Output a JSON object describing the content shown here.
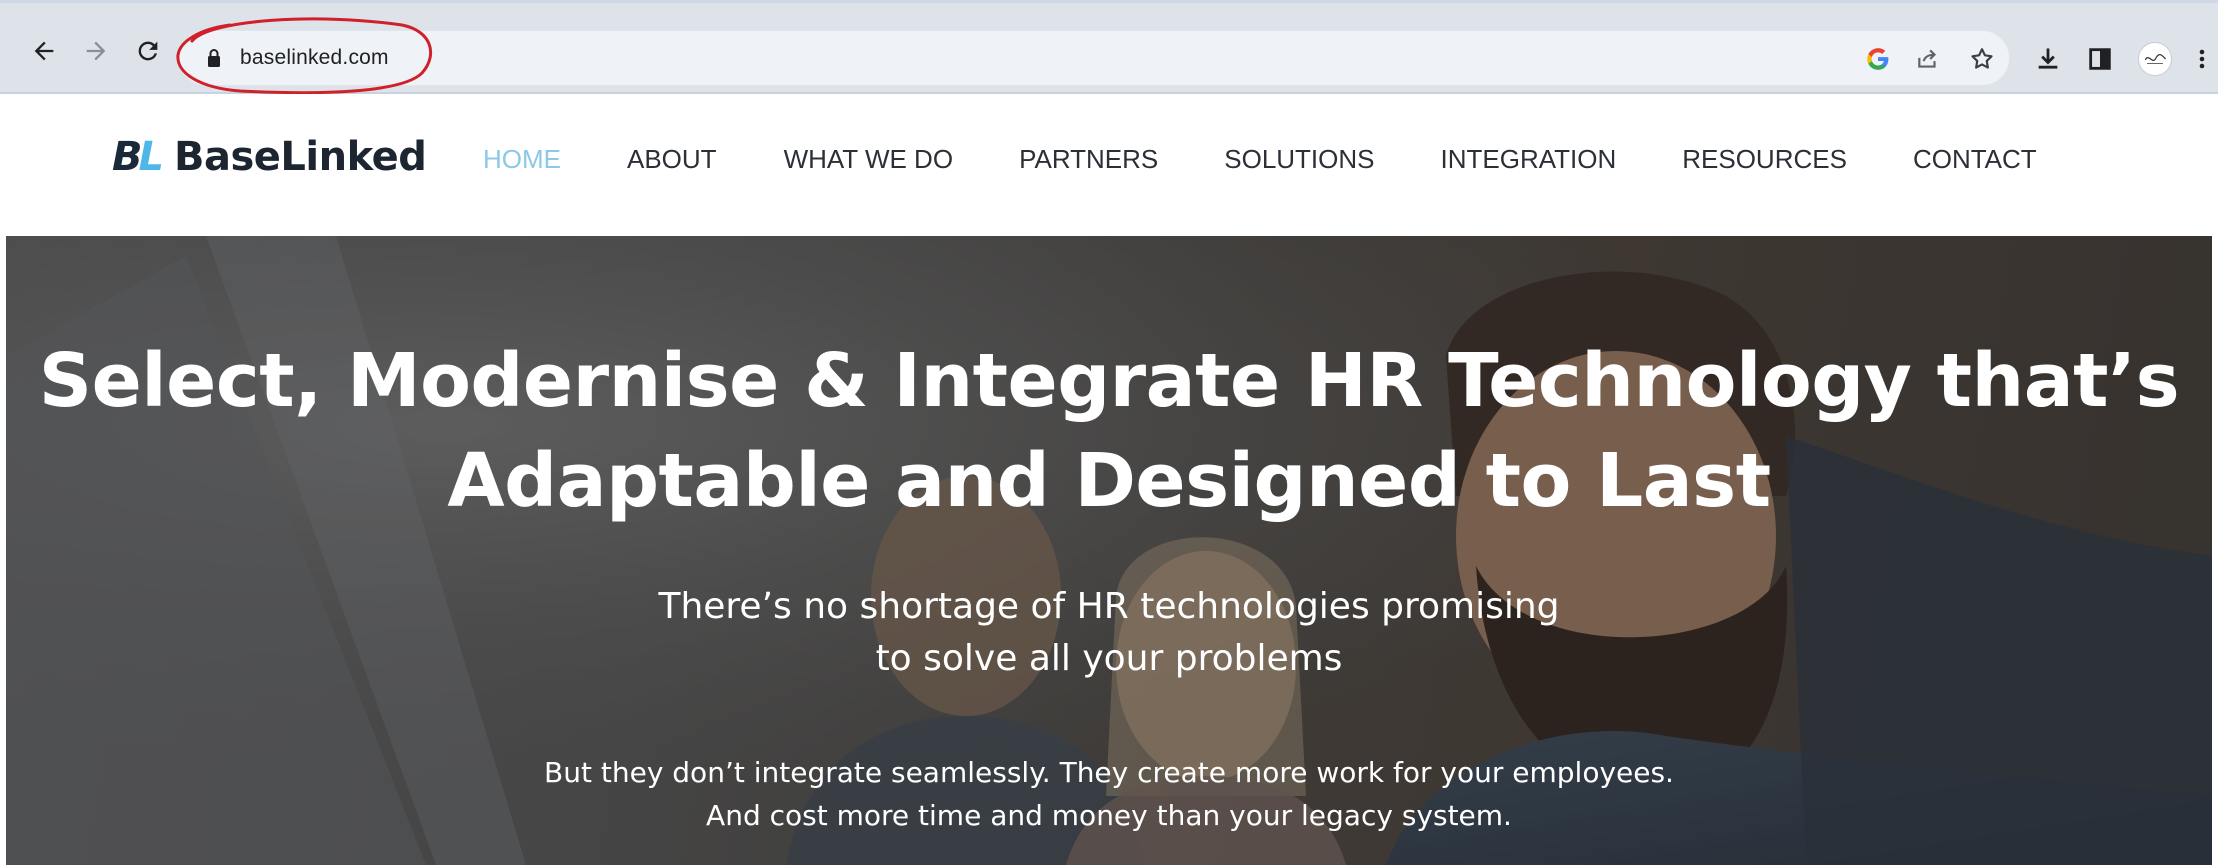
{
  "browser": {
    "url": "baselinked.com",
    "icons": {
      "back": "arrow-left-icon",
      "forward": "arrow-right-icon",
      "reload": "reload-icon",
      "lock": "lock-icon",
      "google": "google-g-icon",
      "share": "share-icon",
      "bookmark": "star-icon",
      "download": "download-icon",
      "side_panel": "side-panel-icon",
      "menu": "kebab-menu-icon"
    },
    "annotation_color": "#d0202a"
  },
  "site": {
    "logo_mark_b": "B",
    "logo_mark_l": "L",
    "logo_text": "BaseLinked",
    "brand_colors": {
      "dark": "#1a2a3a",
      "accent": "#4fb6e8",
      "nav_active": "#8cc8e8"
    },
    "nav": [
      {
        "label": "HOME",
        "active": true
      },
      {
        "label": "ABOUT",
        "active": false
      },
      {
        "label": "WHAT WE DO",
        "active": false
      },
      {
        "label": "PARTNERS",
        "active": false
      },
      {
        "label": "SOLUTIONS",
        "active": false
      },
      {
        "label": "INTEGRATION",
        "active": false
      },
      {
        "label": "RESOURCES",
        "active": false
      },
      {
        "label": "CONTACT",
        "active": false
      }
    ]
  },
  "hero": {
    "title_line1": "Select, Modernise & Integrate HR Technology that’s",
    "title_line2": "Adaptable and Designed to Last",
    "subtitle_line1": "There’s no shortage of HR technologies promising",
    "subtitle_line2": "to solve all your problems",
    "body_line1": "But they don’t integrate seamlessly. They create more work for your employees.",
    "body_line2": "And cost more time and money than your legacy system."
  }
}
